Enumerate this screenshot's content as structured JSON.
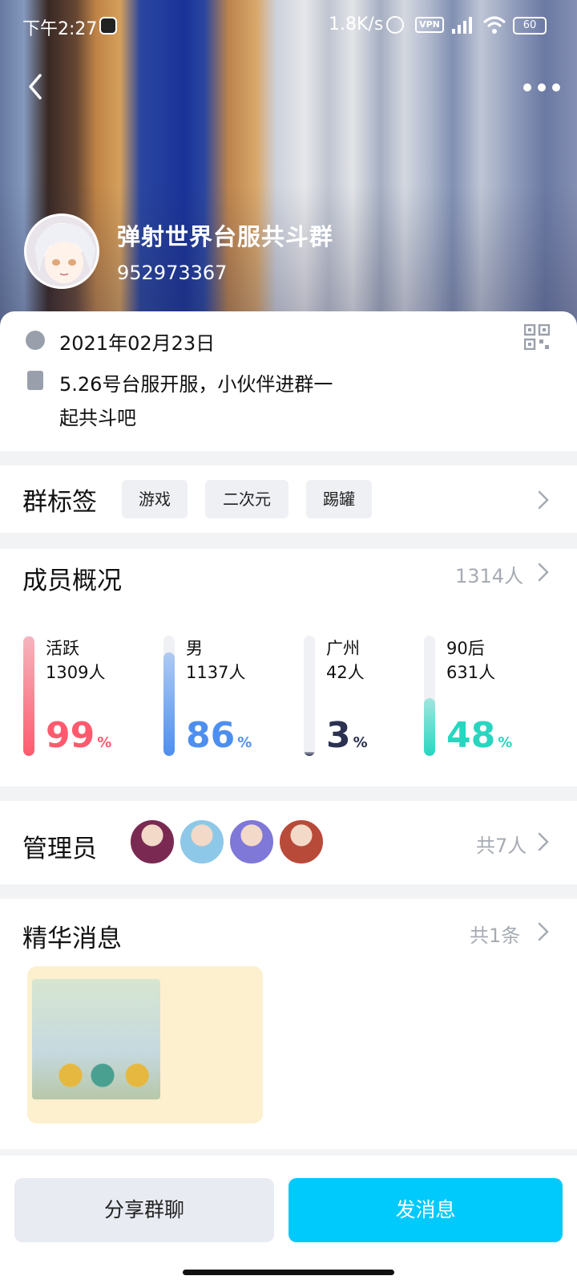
{
  "status_bar": {
    "time": "下午2:27",
    "net_speed": "1.8K/s",
    "vpn": "VPN",
    "battery": "60"
  },
  "header": {
    "group_name": "弹射世界台服共斗群",
    "group_id": "952973367"
  },
  "info": {
    "date": "2021年02月23日",
    "description": "5.26号台服开服，小伙伴进群一起共斗吧"
  },
  "tags": {
    "title": "群标签",
    "items": [
      "游戏",
      "二次元",
      "踢罐"
    ]
  },
  "members": {
    "title": "成员概况",
    "total": "1314人",
    "stats": [
      {
        "label": "活跃",
        "count": "1309人",
        "percent": "99",
        "fill": 0.99,
        "color": "#ff5a6e"
      },
      {
        "label": "男",
        "count": "1137人",
        "percent": "86",
        "fill": 0.86,
        "color": "#4d8ff0"
      },
      {
        "label": "广州",
        "count": "42人",
        "percent": "3",
        "fill": 0.03,
        "color": "#2b3150"
      },
      {
        "label": "90后",
        "count": "631人",
        "percent": "48",
        "fill": 0.48,
        "color": "#28d6c0"
      }
    ],
    "percent_sign": "%"
  },
  "admins": {
    "title": "管理员",
    "total": "共7人",
    "avatar_colors": [
      "#7a2a52",
      "#8ec8e8",
      "#7f78d8",
      "#b84a3a"
    ]
  },
  "featured": {
    "title": "精华消息",
    "total": "共1条"
  },
  "actions": {
    "share": "分享群聊",
    "send": "发消息"
  }
}
